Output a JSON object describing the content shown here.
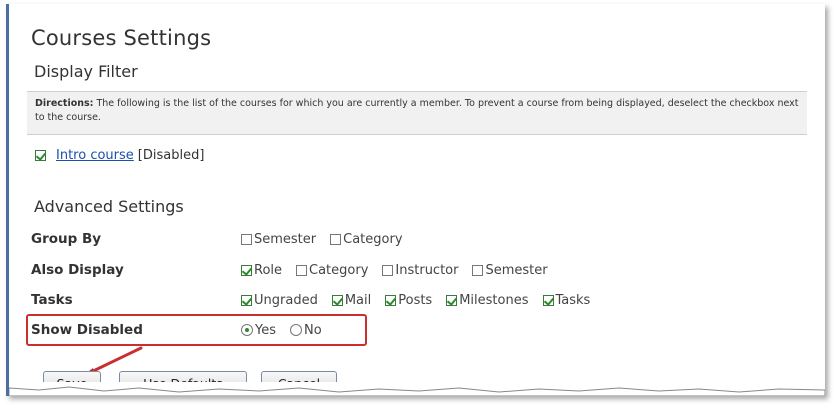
{
  "page_title": "Courses Settings",
  "display_filter": {
    "title": "Display Filter",
    "directions_label": "Directions:",
    "directions_text": " The following is the list of the courses for which you are currently a member. To prevent a course from being displayed, deselect the checkbox next to the course.",
    "course": {
      "name": "Intro course",
      "status": "[Disabled]",
      "checked": true
    }
  },
  "advanced": {
    "title": "Advanced Settings",
    "group_by": {
      "label": "Group By",
      "options": [
        {
          "label": "Semester",
          "checked": false
        },
        {
          "label": "Category",
          "checked": false
        }
      ]
    },
    "also_display": {
      "label": "Also Display",
      "options": [
        {
          "label": "Role",
          "checked": true
        },
        {
          "label": "Category",
          "checked": false
        },
        {
          "label": "Instructor",
          "checked": false
        },
        {
          "label": "Semester",
          "checked": false
        }
      ]
    },
    "tasks": {
      "label": "Tasks",
      "options": [
        {
          "label": "Ungraded",
          "checked": true
        },
        {
          "label": "Mail",
          "checked": true
        },
        {
          "label": "Posts",
          "checked": true
        },
        {
          "label": "Milestones",
          "checked": true
        },
        {
          "label": "Tasks",
          "checked": true
        }
      ]
    },
    "show_disabled": {
      "label": "Show Disabled",
      "options": [
        {
          "label": "Yes",
          "selected": true
        },
        {
          "label": "No",
          "selected": false
        }
      ]
    }
  },
  "buttons": {
    "save": "Save",
    "defaults": "Use Defaults",
    "cancel": "Cancel"
  },
  "colors": {
    "highlight": "#c83030",
    "link": "#1a4fb0",
    "check": "#2c8a2c",
    "frame_rule": "#4a6fa5"
  }
}
